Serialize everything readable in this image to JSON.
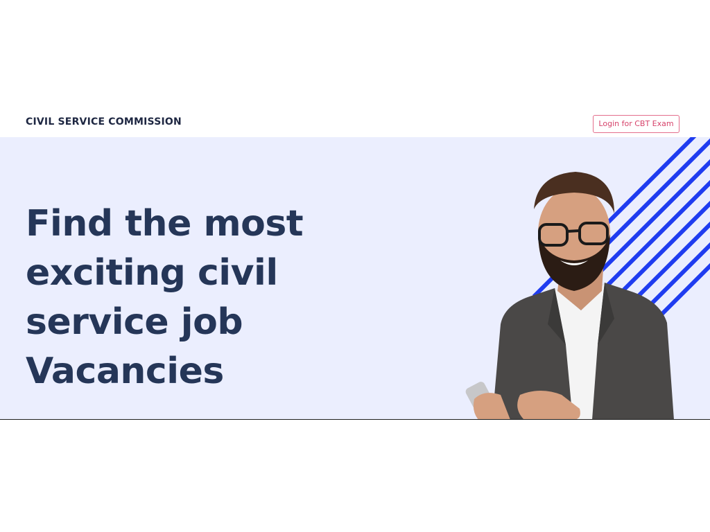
{
  "header": {
    "brand": "CIVIL SERVICE COMMISSION",
    "login_button_label": "Login for CBT Exam"
  },
  "hero": {
    "title": "Find the most exciting civil service job Vacancies",
    "image_subject": "smiling man holding phone"
  },
  "colors": {
    "hero_background": "#ebeefe",
    "title_text": "#253658",
    "brand_text": "#1e2742",
    "login_border": "#e36d8b",
    "login_text": "#d6426a",
    "stripes": "#1f3cf0"
  }
}
